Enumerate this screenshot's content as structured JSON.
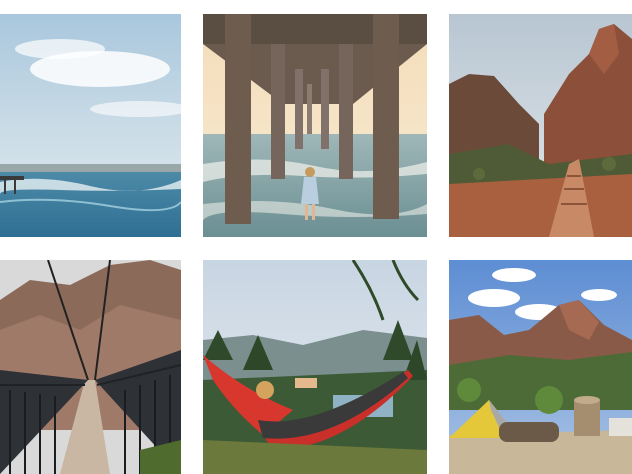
{
  "gallery": {
    "photos": [
      {
        "subject": "beach-coastline-pier"
      },
      {
        "subject": "under-pier-sunset-wading"
      },
      {
        "subject": "canyon-trail"
      },
      {
        "subject": "suspension-bridge-canyon"
      },
      {
        "subject": "hammock-forest-lake"
      },
      {
        "subject": "tent-camp-mountain"
      }
    ]
  }
}
